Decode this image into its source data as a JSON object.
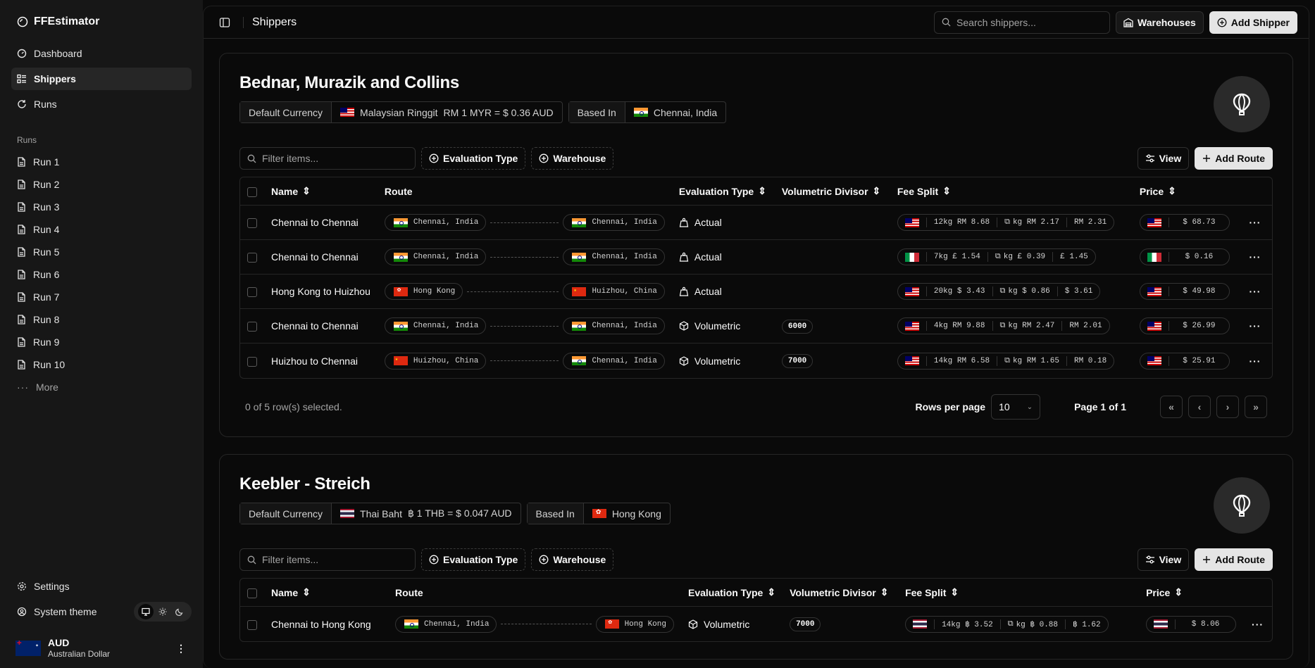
{
  "app": {
    "name": "FFEstimator"
  },
  "nav": [
    {
      "label": "Dashboard",
      "icon": "dashboard-icon",
      "active": false
    },
    {
      "label": "Shippers",
      "icon": "list-icon",
      "active": true
    },
    {
      "label": "Runs",
      "icon": "refresh-icon",
      "active": false
    }
  ],
  "runs_section": {
    "label": "Runs",
    "items": [
      "Run 1",
      "Run 2",
      "Run 3",
      "Run 4",
      "Run 5",
      "Run 6",
      "Run 7",
      "Run 8",
      "Run 9",
      "Run 10"
    ],
    "more": "More"
  },
  "settings": {
    "label": "Settings",
    "theme_label": "System theme"
  },
  "user": {
    "code": "AUD",
    "name": "Australian Dollar"
  },
  "topbar": {
    "title": "Shippers",
    "search_placeholder": "Search shippers...",
    "warehouses": "Warehouses",
    "add_shipper": "Add Shipper"
  },
  "shippers": [
    {
      "name": "Bednar, Murazik and Collins",
      "currency_label": "Default Currency",
      "currency_name": "Malaysian Ringgit",
      "currency_rate": "RM 1 MYR = $ 0.36 AUD",
      "based_label": "Based In",
      "based_in": "Chennai, India",
      "filter_placeholder": "Filter items...",
      "eval_type": "Evaluation Type",
      "warehouse": "Warehouse",
      "view": "View",
      "add_route": "Add Route",
      "columns": {
        "name": "Name",
        "route": "Route",
        "eval": "Evaluation Type",
        "divisor": "Volumetric Divisor",
        "fee": "Fee Split",
        "price": "Price"
      },
      "rows": [
        {
          "name": "Chennai to Chennai",
          "from": "Chennai, India",
          "to": "Chennai, India",
          "eval": "Actual",
          "divisor": "",
          "fee1": "12kg RM 8.68",
          "fee2": "kg RM 2.17",
          "fee3": "RM 2.31",
          "price": "$ 68.73"
        },
        {
          "name": "Chennai to Chennai",
          "from": "Chennai, India",
          "to": "Chennai, India",
          "eval": "Actual",
          "divisor": "",
          "fee1": "7kg £ 1.54",
          "fee2": "kg £ 0.39",
          "fee3": "£ 1.45",
          "price": "$ 0.16"
        },
        {
          "name": "Hong Kong to Huizhou",
          "from": "Hong Kong",
          "to": "Huizhou, China",
          "eval": "Actual",
          "divisor": "",
          "fee1": "20kg $ 3.43",
          "fee2": "kg $ 0.86",
          "fee3": "$ 3.61",
          "price": "$ 49.98"
        },
        {
          "name": "Chennai to Chennai",
          "from": "Chennai, India",
          "to": "Chennai, India",
          "eval": "Volumetric",
          "divisor": "6000",
          "fee1": "4kg RM 9.88",
          "fee2": "kg RM 2.47",
          "fee3": "RM 2.01",
          "price": "$ 26.99"
        },
        {
          "name": "Huizhou to Chennai",
          "from": "Huizhou, China",
          "to": "Chennai, India",
          "eval": "Volumetric",
          "divisor": "7000",
          "fee1": "14kg RM 6.58",
          "fee2": "kg RM 1.65",
          "fee3": "RM 0.18",
          "price": "$ 25.91"
        }
      ],
      "selected_text": "0 of 5 row(s) selected.",
      "rows_per_page_label": "Rows per page",
      "rows_per_page": "10",
      "page_text": "Page 1 of 1"
    },
    {
      "name": "Keebler - Streich",
      "currency_label": "Default Currency",
      "currency_name": "Thai Baht",
      "currency_rate": "฿ 1 THB = $ 0.047 AUD",
      "based_label": "Based In",
      "based_in": "Hong Kong",
      "filter_placeholder": "Filter items...",
      "eval_type": "Evaluation Type",
      "warehouse": "Warehouse",
      "view": "View",
      "add_route": "Add Route",
      "columns": {
        "name": "Name",
        "route": "Route",
        "eval": "Evaluation Type",
        "divisor": "Volumetric Divisor",
        "fee": "Fee Split",
        "price": "Price"
      },
      "rows": [
        {
          "name": "Chennai to Hong Kong",
          "from": "Chennai, India",
          "to": "Hong Kong",
          "eval": "Volumetric",
          "divisor": "7000",
          "fee1": "14kg ฿ 3.52",
          "fee2": "kg ฿ 0.88",
          "fee3": "฿ 1.62",
          "price": "$ 8.06"
        }
      ]
    }
  ]
}
